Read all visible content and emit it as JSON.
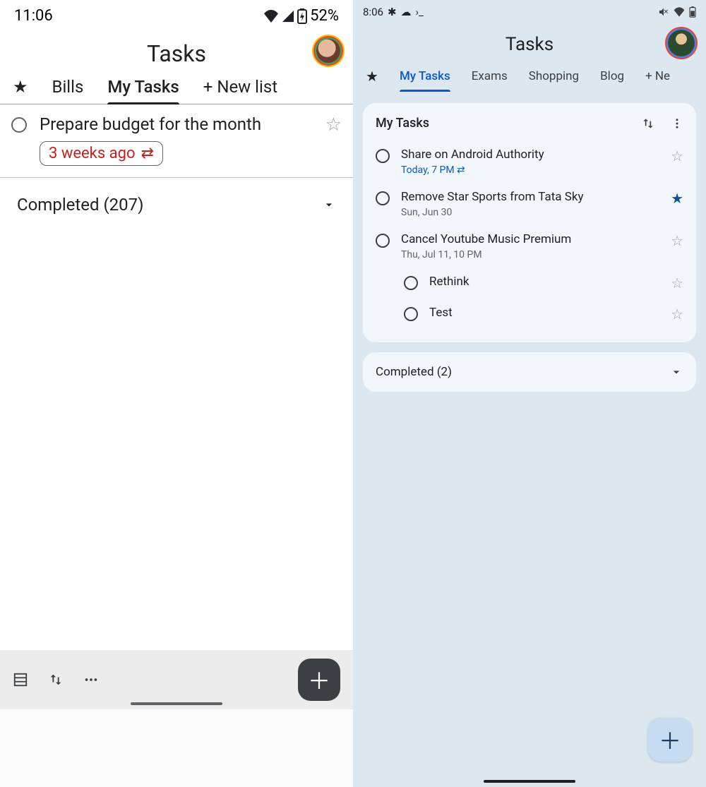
{
  "left": {
    "status": {
      "time": "11:06",
      "battery": "52%"
    },
    "title": "Tasks",
    "tabs": {
      "t0": "Bills",
      "t1": "My Tasks",
      "t2": "+ New list"
    },
    "task": {
      "title": "Prepare budget for the month",
      "date": "3 weeks ago"
    },
    "completed": "Completed (207)"
  },
  "right": {
    "status": {
      "time": "8:06"
    },
    "title": "Tasks",
    "tabs": {
      "t0": "My Tasks",
      "t1": "Exams",
      "t2": "Shopping",
      "t3": "Blog",
      "t4": "+  Ne"
    },
    "card_title": "My Tasks",
    "tasks": {
      "r0": {
        "title": "Share on Android Authority",
        "date": "Today, 7 PM ⇄"
      },
      "r1": {
        "title": "Remove Star Sports from Tata Sky",
        "date": "Sun, Jun 30"
      },
      "r2": {
        "title": "Cancel Youtube Music Premium",
        "date": "Thu, Jul 11, 10 PM"
      },
      "r3": {
        "title": "Rethink"
      },
      "r4": {
        "title": "Test"
      }
    },
    "completed": "Completed (2)"
  }
}
